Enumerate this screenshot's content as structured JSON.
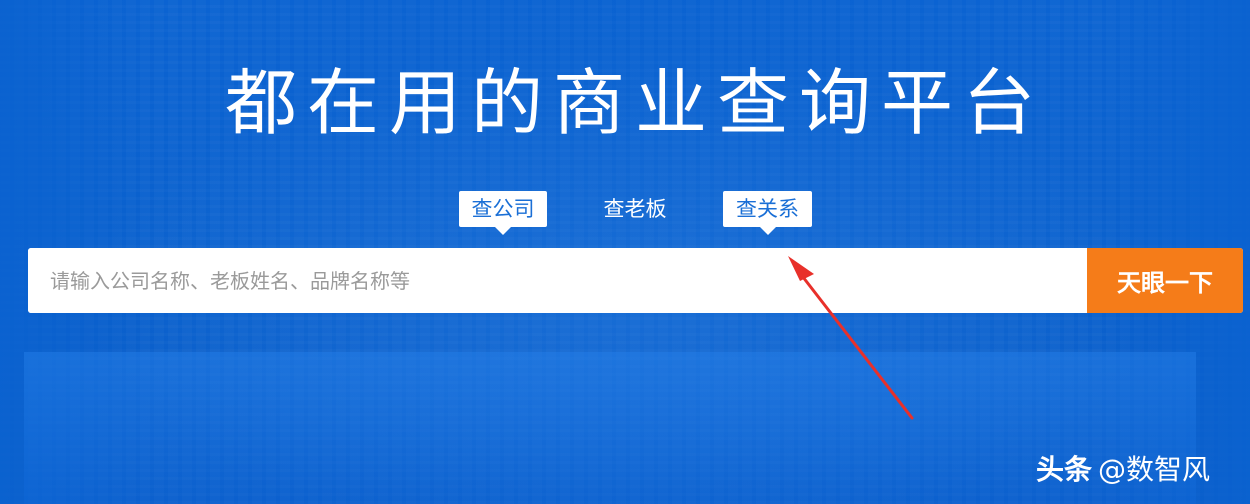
{
  "headline": "都在用的商业查询平台",
  "tabs": [
    {
      "label": "查公司",
      "selected": true
    },
    {
      "label": "查老板",
      "selected": false
    },
    {
      "label": "查关系",
      "selected": true
    }
  ],
  "search": {
    "placeholder": "请输入公司名称、老板姓名、品牌名称等",
    "value": "",
    "button_label": "天眼一下"
  },
  "watermark": {
    "brand": "头条",
    "handle": "@数智风"
  },
  "colors": {
    "background": "#0a62d0",
    "accent_button": "#f57c19",
    "tab_text_active": "#1a6fd6",
    "annotation_arrow": "#e8302a"
  }
}
